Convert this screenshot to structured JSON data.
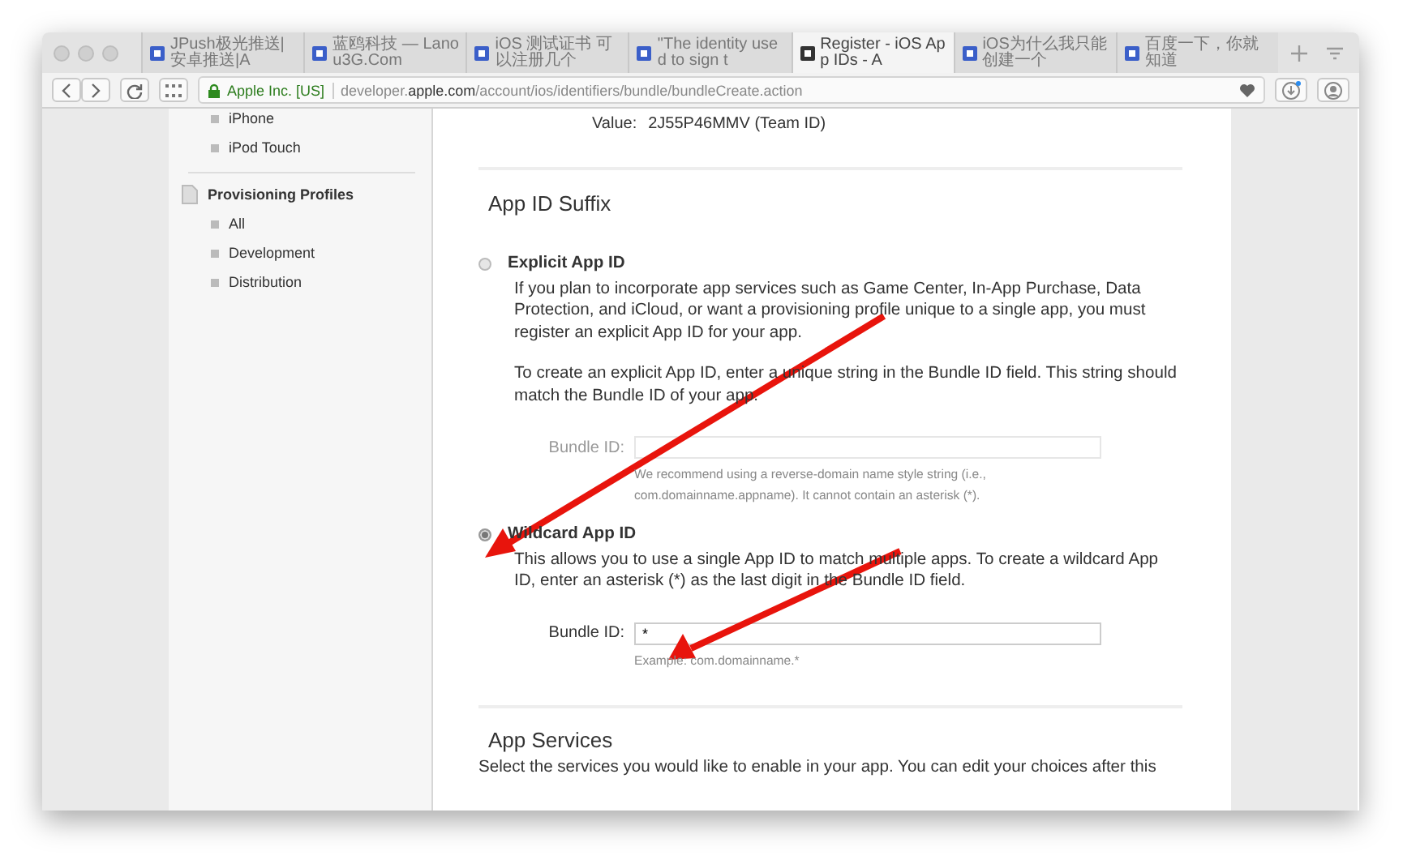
{
  "browser": {
    "tabs": [
      {
        "title": "JPush极光推送|安卓推送|A",
        "selected": false
      },
      {
        "title": "蓝鸥科技 — Lanou3G.Com",
        "selected": false
      },
      {
        "title": "iOS 测试证书 可以注册几个",
        "selected": false
      },
      {
        "title": "\"The identity used to sign t",
        "selected": false
      },
      {
        "title": "Register - iOS App IDs - A",
        "selected": true
      },
      {
        "title": "iOS为什么我只能创建一个",
        "selected": false
      },
      {
        "title": "百度一下，你就知道",
        "selected": false
      }
    ],
    "identity": "Apple Inc. [US]",
    "url": "developer.**apple.com**/account/ios/identifiers/bundle/bundleCreate.action"
  },
  "sidebar": {
    "top_items": [
      "iPhone",
      "iPod Touch"
    ],
    "section": {
      "title": "Provisioning Profiles",
      "items": [
        "All",
        "Development",
        "Distribution"
      ]
    }
  },
  "main": {
    "value_label": "Value:",
    "value": "2J55P46MMV (Team ID)",
    "suffix_title": "App ID Suffix",
    "options": [
      {
        "title": "Explicit App ID",
        "selected": false,
        "paragraphs": [
          "If you plan to incorporate app services such as Game Center, In-App Purchase, Data Protection, and iCloud, or want a provisioning profile unique to a single app, you must register an explicit App ID for your app.",
          "To create an explicit App ID, enter a unique string in the Bundle ID field. This string should match the Bundle ID of your app."
        ],
        "field": {
          "label": "Bundle ID:",
          "disabled": true
        },
        "hint": "We recommend using a reverse-domain name style string (i.e., com.domainname.appname). It cannot contain an asterisk (*)."
      },
      {
        "title": "Wildcard App ID",
        "selected": true,
        "paragraphs": [
          "This allows you to use a single App ID to match multiple apps. To create a wildcard App ID, enter an asterisk (*) as the last digit in the Bundle ID field."
        ],
        "field": {
          "label": "Bundle ID:",
          "value": "*",
          "disabled": false
        },
        "hint": "Example: com.domainname.*"
      }
    ],
    "services_title": "App Services",
    "services_text": "Select the services you would like to enable in your app. You can edit your choices after this"
  }
}
